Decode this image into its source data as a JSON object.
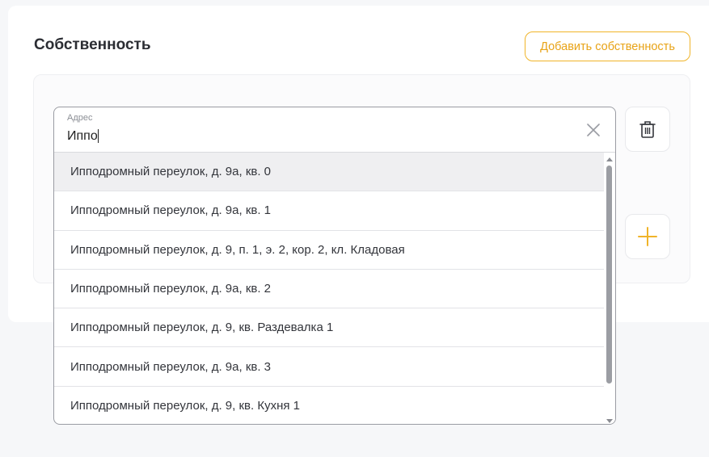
{
  "section": {
    "title": "Собственность",
    "add_button_label": "Добавить собственность"
  },
  "address_field": {
    "label": "Адрес",
    "value": "Иппо"
  },
  "suggestions": [
    "Ипподромный переулок, д. 9а, кв. 0",
    "Ипподромный переулок, д. 9а, кв. 1",
    "Ипподромный переулок, д. 9, п. 1, э. 2, кор. 2, кл. Кладовая",
    "Ипподромный переулок, д. 9а, кв. 2",
    "Ипподромный переулок, д. 9, кв. Раздевалка 1",
    "Ипподромный переулок, д. 9а, кв. 3",
    "Ипподромный переулок, д. 9, кв. Кухня 1"
  ],
  "icons": {
    "clear": "close-icon",
    "delete": "trash-icon",
    "add": "plus-icon"
  },
  "colors": {
    "accent": "#f0b429",
    "accent_text": "#e8a317",
    "highlight_row": "#efeff1"
  }
}
